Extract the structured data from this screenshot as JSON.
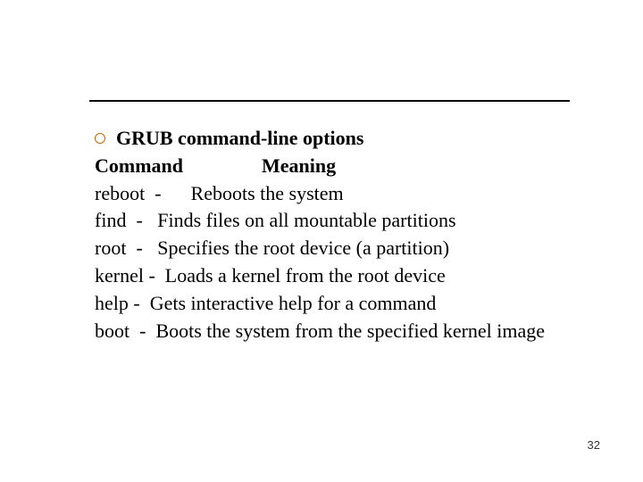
{
  "title": "GRUB command-line options",
  "header_command": "Command",
  "header_meaning": "Meaning",
  "rows": [
    "reboot  -      Reboots the system",
    "find  -   Finds files on all mountable partitions",
    "root  -   Specifies the root device (a partition)",
    "kernel -  Loads a kernel from the root device",
    "help -  Gets interactive help for a command",
    "boot  -  Boots the system from the specified kernel image"
  ],
  "page_number": "32"
}
